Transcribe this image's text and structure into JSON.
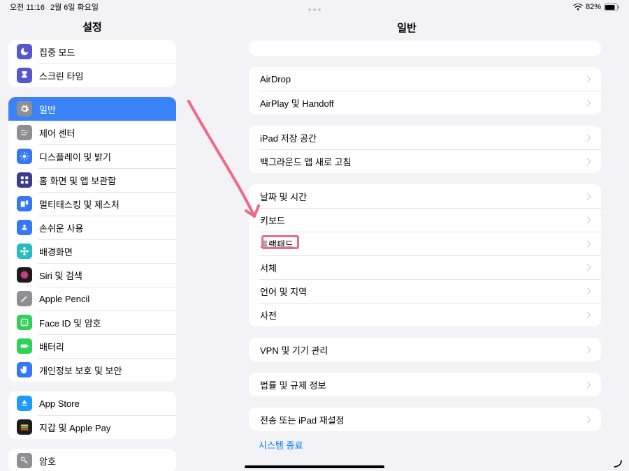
{
  "status": {
    "time": "오전 11:16",
    "date": "2월 6일 화요일",
    "battery_pct": "82%"
  },
  "sidebar_title": "설정",
  "detail_title": "일반",
  "sidebar": {
    "groups": [
      [
        {
          "id": "focus",
          "label": "집중 모드",
          "bg": "#5756ce",
          "svg": "moon"
        },
        {
          "id": "screentime",
          "label": "스크린 타임",
          "bg": "#5756ce",
          "svg": "hourglass"
        }
      ],
      [
        {
          "id": "general",
          "label": "일반",
          "bg": "#8e8e93",
          "svg": "gear",
          "selected": true
        },
        {
          "id": "control",
          "label": "제어 센터",
          "bg": "#8e8e93",
          "svg": "sliders"
        },
        {
          "id": "display",
          "label": "디스플레이 및 밝기",
          "bg": "#3478f6",
          "svg": "sun"
        },
        {
          "id": "home",
          "label": "홈 화면 및 앱 보관함",
          "bg": "#3a3a8f",
          "svg": "grid"
        },
        {
          "id": "multi",
          "label": "멀티태스킹 및 제스처",
          "bg": "#3478f6",
          "svg": "rects"
        },
        {
          "id": "access",
          "label": "손쉬운 사용",
          "bg": "#3478f6",
          "svg": "person"
        },
        {
          "id": "wallpaper",
          "label": "배경화면",
          "bg": "#27bdbe",
          "svg": "flower"
        },
        {
          "id": "siri",
          "label": "Siri 및 검색",
          "bg": "#1c1c1e",
          "svg": "siri"
        },
        {
          "id": "pencil",
          "label": "Apple Pencil",
          "bg": "#8e8e93",
          "svg": "pencil"
        },
        {
          "id": "faceid",
          "label": "Face ID 및 암호",
          "bg": "#30d158",
          "svg": "face"
        },
        {
          "id": "battery",
          "label": "배터리",
          "bg": "#30d158",
          "svg": "battery"
        },
        {
          "id": "privacy",
          "label": "개인정보 보호 및 보안",
          "bg": "#3478f6",
          "svg": "hand"
        }
      ],
      [
        {
          "id": "appstore",
          "label": "App Store",
          "bg": "#1f9cf8",
          "svg": "astore"
        },
        {
          "id": "wallet",
          "label": "지갑 및 Apple Pay",
          "bg": "#1c1c1e",
          "svg": "wallet"
        }
      ],
      [
        {
          "id": "passwords",
          "label": "암호",
          "bg": "#8e8e93",
          "svg": "key"
        }
      ]
    ]
  },
  "detail": {
    "groups": [
      [
        {
          "id": "airdrop",
          "label": "AirDrop"
        },
        {
          "id": "airplay",
          "label": "AirPlay 및 Handoff"
        }
      ],
      [
        {
          "id": "storage",
          "label": "iPad 저장 공간"
        },
        {
          "id": "bgrefresh",
          "label": "백그라운드 앱 새로 고침"
        }
      ],
      [
        {
          "id": "datetime",
          "label": "날짜 및 시간"
        },
        {
          "id": "keyboard",
          "label": "키보드"
        },
        {
          "id": "trackpad",
          "label": "트랙패드"
        },
        {
          "id": "fonts",
          "label": "서체"
        },
        {
          "id": "lang",
          "label": "언어 및 지역"
        },
        {
          "id": "dict",
          "label": "사전"
        }
      ],
      [
        {
          "id": "vpn",
          "label": "VPN 및 기기 관리"
        }
      ],
      [
        {
          "id": "legal",
          "label": "법률 및 규제 정보"
        }
      ],
      [
        {
          "id": "reset",
          "label": "전송 또는 iPad 재설정"
        }
      ]
    ],
    "footer_link": "시스템 종료"
  }
}
